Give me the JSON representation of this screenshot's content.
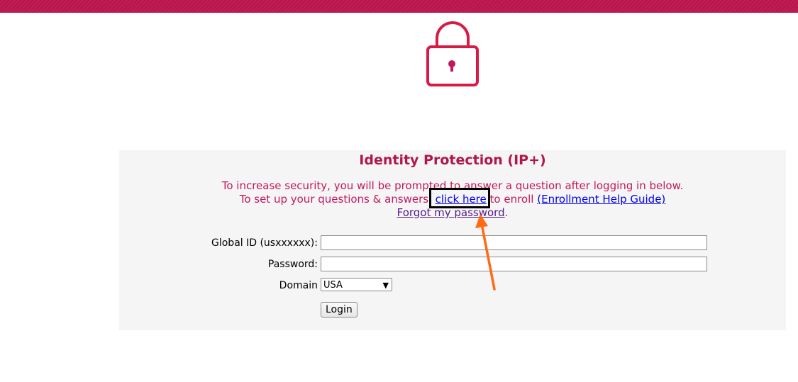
{
  "header": {
    "accent_color": "#b5164c"
  },
  "lock_icon": "lock-icon",
  "panel": {
    "title": "Identity Protection (IP+)",
    "line1": "To increase security, you will be prompted to answer a question after logging in below.",
    "line2_prefix": "To set up your questions & answers,",
    "click_here": "click here",
    "line2_middle": "to enroll",
    "enroll_guide": "(Enrollment Help Guide)",
    "forgot_password": "Forgot my password",
    "forgot_suffix": "."
  },
  "form": {
    "global_id_label": "Global ID (usxxxxxx):",
    "global_id_value": "",
    "password_label": "Password:",
    "password_value": "",
    "domain_label": "Domain",
    "domain_selected": "USA",
    "login_button": "Login"
  },
  "annotation": {
    "highlight_color": "#000000",
    "arrow_color": "#ff6a13"
  }
}
